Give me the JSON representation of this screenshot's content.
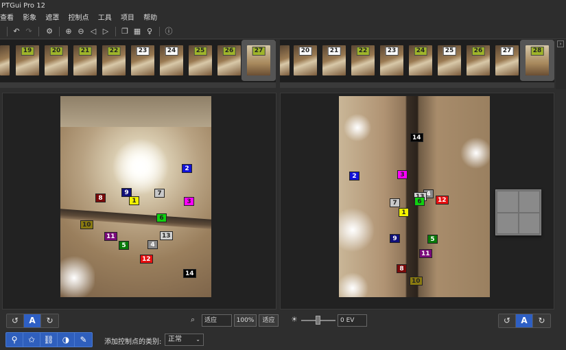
{
  "title": "PTGui Pro 12",
  "menu": [
    "查看",
    "影象",
    "遮罩",
    "控制点",
    "工具",
    "项目",
    "帮助"
  ],
  "left_thumbs": [
    {
      "n": "19",
      "c": "g"
    },
    {
      "n": "20",
      "c": "g"
    },
    {
      "n": "21",
      "c": "g"
    },
    {
      "n": "22",
      "c": "g"
    },
    {
      "n": "23",
      "c": "w"
    },
    {
      "n": "24",
      "c": "w"
    },
    {
      "n": "25",
      "c": "g"
    },
    {
      "n": "26",
      "c": "g"
    },
    {
      "n": "27",
      "c": "g",
      "sel": true
    }
  ],
  "right_thumbs": [
    {
      "n": "20",
      "c": "w"
    },
    {
      "n": "21",
      "c": "w"
    },
    {
      "n": "22",
      "c": "g"
    },
    {
      "n": "23",
      "c": "w"
    },
    {
      "n": "24",
      "c": "g"
    },
    {
      "n": "25",
      "c": "w"
    },
    {
      "n": "26",
      "c": "g"
    },
    {
      "n": "27",
      "c": "w"
    },
    {
      "n": "28",
      "c": "g",
      "sel": true
    }
  ],
  "left_points": [
    {
      "n": "2",
      "bg": "#1212d8",
      "fg": "#fff"
    },
    {
      "n": "9",
      "bg": "#10107a",
      "fg": "#fff"
    },
    {
      "n": "7",
      "bg": "#c8c8c8",
      "fg": "#222"
    },
    {
      "n": "8",
      "bg": "#7a0a0a",
      "fg": "#fff"
    },
    {
      "n": "1",
      "bg": "#f2f200",
      "fg": "#222"
    },
    {
      "n": "3",
      "bg": "#ff00ff",
      "fg": "#222"
    },
    {
      "n": "6",
      "bg": "#10d010",
      "fg": "#222"
    },
    {
      "n": "10",
      "bg": "#8a7a10",
      "fg": "#222"
    },
    {
      "n": "11",
      "bg": "#7a0a7a",
      "fg": "#fff"
    },
    {
      "n": "13",
      "bg": "#d0d0d0",
      "fg": "#222"
    },
    {
      "n": "5",
      "bg": "#0a7a0a",
      "fg": "#fff"
    },
    {
      "n": "4",
      "bg": "#8a8a8a",
      "fg": "#fff"
    },
    {
      "n": "12",
      "bg": "#e81010",
      "fg": "#fff"
    },
    {
      "n": "14",
      "bg": "#000",
      "fg": "#fff"
    }
  ],
  "right_points": [
    {
      "n": "14",
      "bg": "#000",
      "fg": "#fff"
    },
    {
      "n": "2",
      "bg": "#1212d8",
      "fg": "#fff"
    },
    {
      "n": "3",
      "bg": "#ff00ff",
      "fg": "#222"
    },
    {
      "n": "4",
      "bg": "#8a8a8a",
      "fg": "#fff"
    },
    {
      "n": "13",
      "bg": "#d0d0d0",
      "fg": "#222"
    },
    {
      "n": "6",
      "bg": "#10d010",
      "fg": "#222"
    },
    {
      "n": "12",
      "bg": "#e81010",
      "fg": "#fff"
    },
    {
      "n": "7",
      "bg": "#c8c8c8",
      "fg": "#222"
    },
    {
      "n": "1",
      "bg": "#f2f200",
      "fg": "#222"
    },
    {
      "n": "9",
      "bg": "#10107a",
      "fg": "#fff"
    },
    {
      "n": "5",
      "bg": "#0a7a0a",
      "fg": "#fff"
    },
    {
      "n": "11",
      "bg": "#7a0a7a",
      "fg": "#fff"
    },
    {
      "n": "8",
      "bg": "#7a0a0a",
      "fg": "#fff"
    },
    {
      "n": "10",
      "bg": "#8a7a10",
      "fg": "#222"
    }
  ],
  "left_zoom": {
    "value": "适应",
    "pct": "100%",
    "fit": "适应"
  },
  "exposure": {
    "value": "0 EV"
  },
  "rotate": {
    "ccw": "↺",
    "auto": "A",
    "cw": "↻"
  },
  "cp_tools": [
    "⚲",
    "✩",
    "⛓",
    "◑",
    "✎"
  ],
  "cp_type": {
    "label": "添加控制点的类别:",
    "value": "正常"
  }
}
